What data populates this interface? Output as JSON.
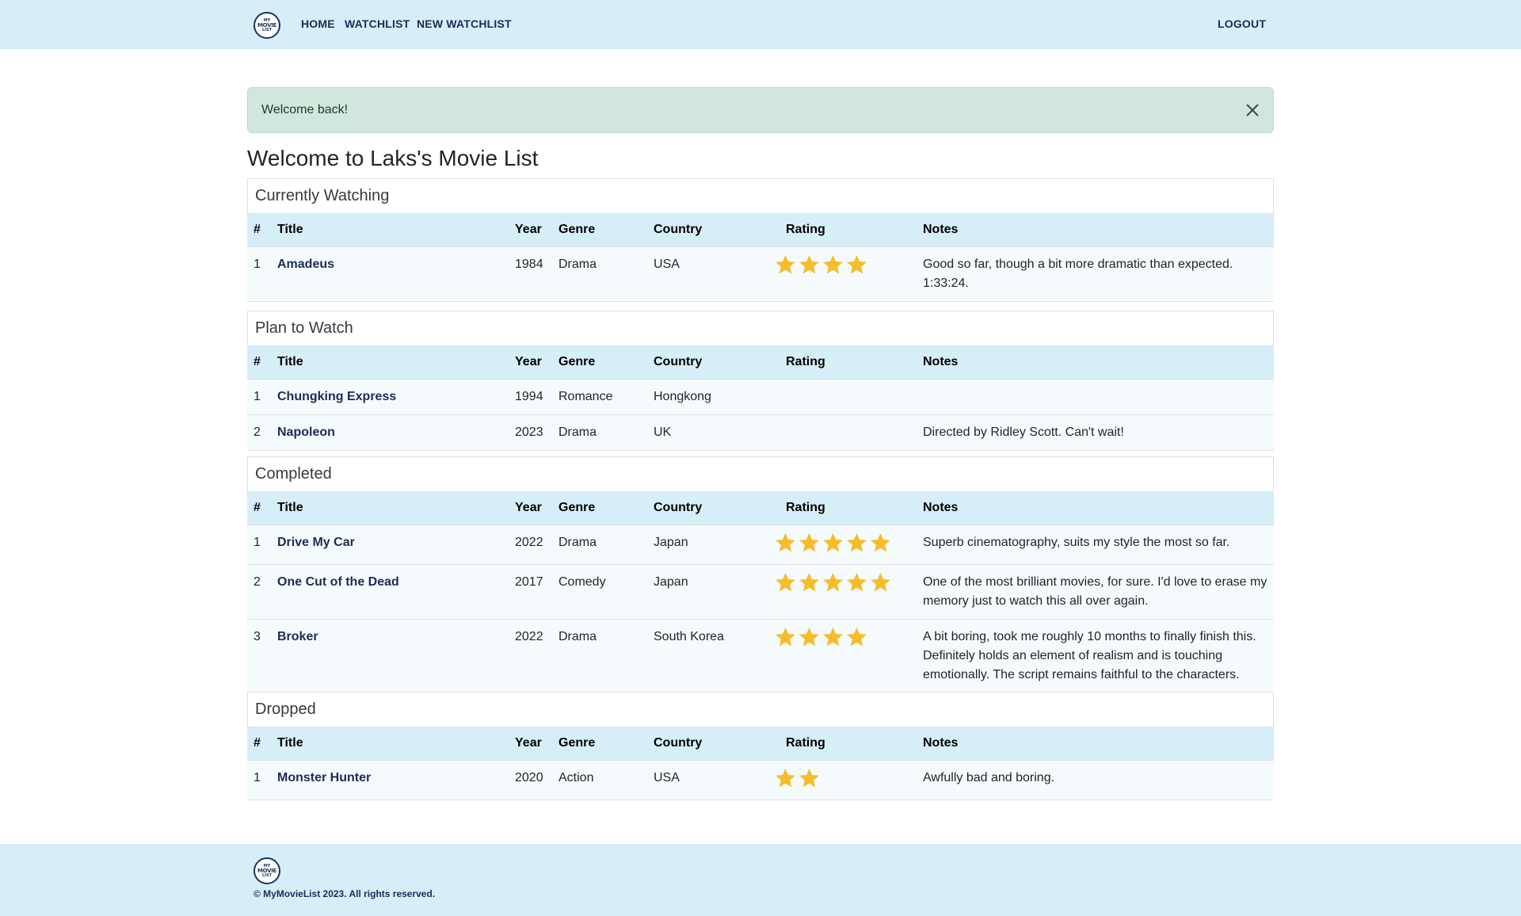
{
  "nav": {
    "logo": {
      "line1": "MY",
      "line2": "MOVIE",
      "line3": "LIST"
    },
    "links": [
      {
        "label": "HOME"
      },
      {
        "label": "WATCHLIST"
      },
      {
        "label": "NEW WATCHLIST"
      }
    ],
    "logout_label": "LOGOUT"
  },
  "alert": {
    "message": "Welcome back!",
    "close_icon": "close-icon"
  },
  "page_title": "Welcome to Laks's Movie List",
  "columns": [
    "#",
    "Title",
    "Year",
    "Genre",
    "Country",
    "Rating",
    "Notes"
  ],
  "sections": [
    {
      "title": "Currently Watching",
      "rows": [
        {
          "num": "1",
          "title": "Amadeus",
          "year": "1984",
          "genre": "Drama",
          "country": "USA",
          "rating": 4,
          "notes": "Good so far, though a bit more dramatic than expected. 1:33:24."
        }
      ]
    },
    {
      "title": "Plan to Watch",
      "rows": [
        {
          "num": "1",
          "title": "Chungking Express",
          "year": "1994",
          "genre": "Romance",
          "country": "Hongkong",
          "rating": 0,
          "notes": ""
        },
        {
          "num": "2",
          "title": "Napoleon",
          "year": "2023",
          "genre": "Drama",
          "country": "UK",
          "rating": 0,
          "notes": "Directed by Ridley Scott. Can't wait!"
        }
      ]
    },
    {
      "title": "Completed",
      "rows": [
        {
          "num": "1",
          "title": "Drive My Car",
          "year": "2022",
          "genre": "Drama",
          "country": "Japan",
          "rating": 5,
          "notes": "Superb cinematography, suits my style the most so far."
        },
        {
          "num": "2",
          "title": "One Cut of the Dead",
          "year": "2017",
          "genre": "Comedy",
          "country": "Japan",
          "rating": 5,
          "notes": "One of the most brilliant movies, for sure. I'd love to erase my memory just to watch this all over again."
        },
        {
          "num": "3",
          "title": "Broker",
          "year": "2022",
          "genre": "Drama",
          "country": "South Korea",
          "rating": 4,
          "notes": "A bit boring, took me roughly 10 months to finally finish this. Definitely holds an element of realism and is touching emotionally. The script remains faithful to the characters."
        }
      ]
    },
    {
      "title": "Dropped",
      "rows": [
        {
          "num": "1",
          "title": "Monster Hunter",
          "year": "2020",
          "genre": "Action",
          "country": "USA",
          "rating": 2,
          "notes": "Awfully bad and boring."
        }
      ]
    }
  ],
  "footer": {
    "copyright": "© MyMovieList 2023. All rights reserved."
  },
  "colors": {
    "navbar_bg": "#d6eef8",
    "alert_bg": "#d1e7dd",
    "star": "#f4bd2c",
    "link": "#1d2b55"
  }
}
